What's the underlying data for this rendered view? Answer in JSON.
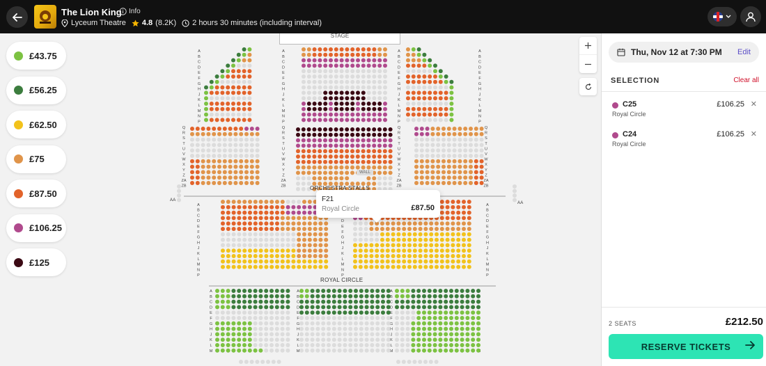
{
  "header": {
    "title": "The Lion King",
    "info_label": "Info",
    "venue": "Lyceum Theatre",
    "rating": "4.8",
    "rating_count": "(8.2K)",
    "duration": "2 hours 30 minutes (including interval)"
  },
  "legend": {
    "prices": [
      {
        "label": "£43.75",
        "color": "#7cc242"
      },
      {
        "label": "£56.25",
        "color": "#3c7d3e"
      },
      {
        "label": "£62.50",
        "color": "#f2c21b"
      },
      {
        "label": "£75",
        "color": "#e0944a"
      },
      {
        "label": "£87.50",
        "color": "#e2632a"
      },
      {
        "label": "£106.25",
        "color": "#b04a8d"
      },
      {
        "label": "£125",
        "color": "#3b0a14"
      }
    ]
  },
  "map": {
    "stage_label": "STAGE",
    "orchestra_label": "ORCHESTRA STALLS",
    "royal_circle_label": "ROYAL CIRCLE",
    "wall_label": "WALL",
    "aa_label": "AA",
    "stalls_rows": [
      "A",
      "B",
      "C",
      "D",
      "E",
      "F",
      "G",
      "H",
      "J",
      "K",
      "L",
      "M",
      "N",
      "P",
      "Q",
      "R",
      "S",
      "T",
      "U",
      "V",
      "W",
      "X",
      "Y",
      "Z",
      "ZA",
      "ZB"
    ],
    "circle_rows": [
      "AA",
      "A",
      "B",
      "C",
      "D",
      "E",
      "F",
      "G",
      "H",
      "J",
      "K",
      "L",
      "M",
      "N",
      "P"
    ],
    "grand_rows": [
      "A",
      "B",
      "C",
      "D",
      "E",
      "F",
      "G",
      "H",
      "J",
      "K",
      "L",
      "M"
    ]
  },
  "tooltip": {
    "seat": "F21",
    "section": "Royal Circle",
    "price": "£87.50"
  },
  "panel": {
    "date": "Thu, Nov 12 at 7:30 PM",
    "edit_label": "Edit",
    "selection_title": "SELECTION",
    "clear_all_label": "Clear all",
    "selected": [
      {
        "seat": "C25",
        "section": "Royal Circle",
        "price": "£106.25",
        "color": "#b04a8d"
      },
      {
        "seat": "C24",
        "section": "Royal Circle",
        "price": "£106.25",
        "color": "#b04a8d"
      }
    ],
    "seats_count": "2 SEATS",
    "total": "£212.50",
    "reserve_label": "RESERVE TICKETS"
  },
  "colors": {
    "accent": "#2de4b4",
    "clear": "#d0112b",
    "edit": "#5b4ec7"
  }
}
